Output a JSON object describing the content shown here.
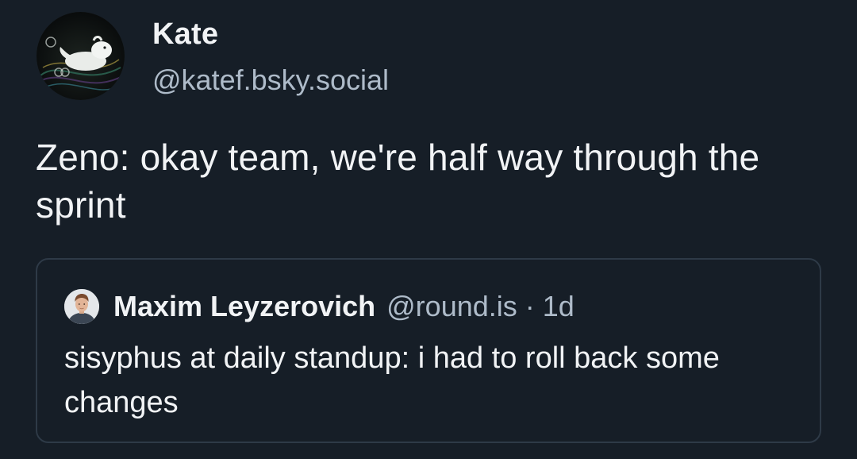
{
  "post": {
    "author": {
      "display_name": "Kate",
      "handle": "@katef.bsky.social",
      "avatar_icon": "white-creature-on-dark-swirls-avatar"
    },
    "text": "Zeno: okay team, we're half way through the sprint"
  },
  "quoted_post": {
    "author": {
      "display_name": "Maxim Leyzerovich",
      "handle": "@round.is",
      "avatar_icon": "man-portrait-avatar"
    },
    "separator": "·",
    "time": "1d",
    "text": "sisyphus at daily standup: i had to roll back some changes"
  },
  "colors": {
    "background": "#161e27",
    "primary_text": "#f1f3f5",
    "secondary_text": "#aebbc9",
    "card_border": "#2e3a47"
  }
}
